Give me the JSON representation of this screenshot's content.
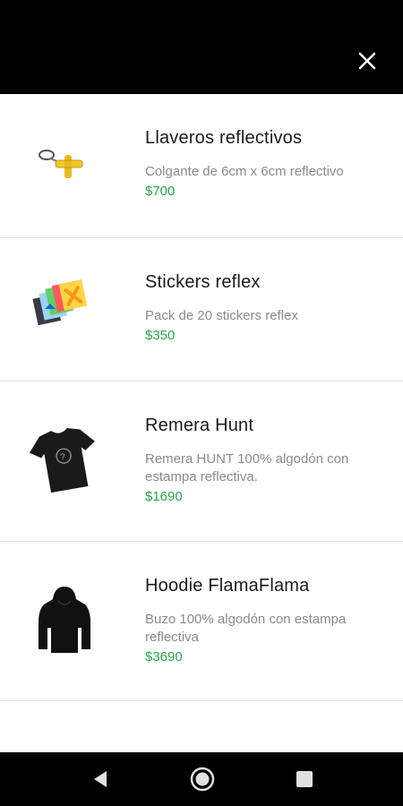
{
  "header": {
    "close_icon": "close-icon"
  },
  "products": [
    {
      "title": "Llaveros reflectivos",
      "description": "Colgante de 6cm x 6cm reflectivo",
      "price": "$700",
      "image": "keychain-image"
    },
    {
      "title": "Stickers reflex",
      "description": "Pack de 20 stickers reflex",
      "price": "$350",
      "image": "stickers-image"
    },
    {
      "title": "Remera Hunt",
      "description": "Remera HUNT 100% algodón con estampa reflectiva.",
      "price": "$1690",
      "image": "tshirt-image"
    },
    {
      "title": "Hoodie FlamaFlama",
      "description": "Buzo 100% algodón con estampa reflectiva",
      "price": "$3690",
      "image": "hoodie-image"
    }
  ],
  "colors": {
    "price": "#2aa845",
    "bar": "#000000"
  },
  "navbar": {
    "back_icon": "back-triangle-icon",
    "home_icon": "home-circle-icon",
    "recents_icon": "recents-square-icon"
  }
}
